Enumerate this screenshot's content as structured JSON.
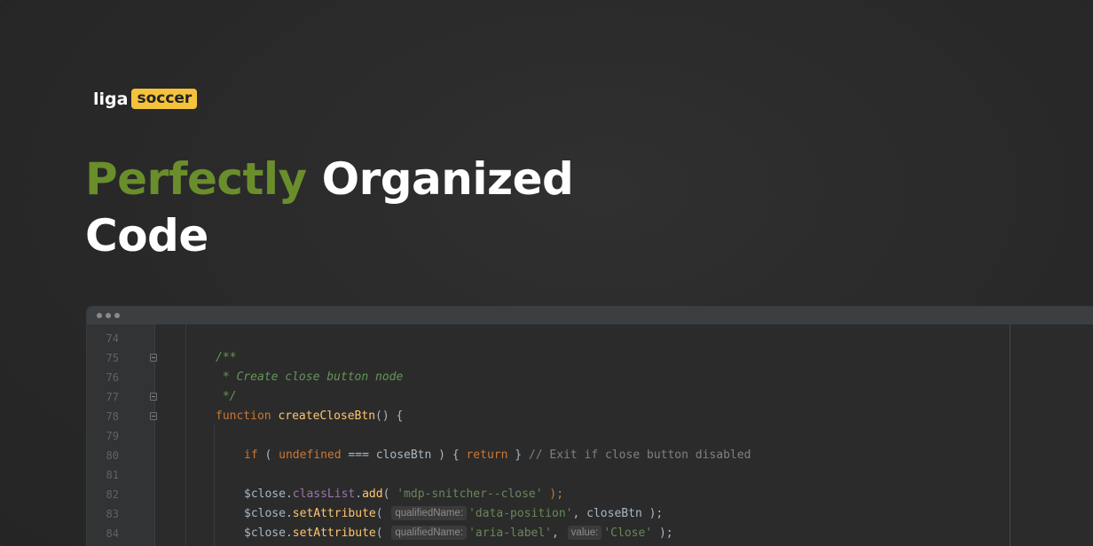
{
  "logo": {
    "liga": "liga",
    "soccer": "soccer"
  },
  "headline": {
    "accent": "Perfectly",
    "rest": "Organized",
    "line2": "Code"
  },
  "editor": {
    "lines": [
      {
        "num": "74"
      },
      {
        "num": "75",
        "t1": "/**"
      },
      {
        "num": "76",
        "t1": " * Create close button node"
      },
      {
        "num": "77",
        "t1": " */"
      },
      {
        "num": "78",
        "kw": "function",
        "fn": "createCloseBtn",
        "rest": "() {"
      },
      {
        "num": "79"
      },
      {
        "num": "80",
        "kw1": "if",
        "p1": " ( ",
        "kw2": "undefined",
        "p2": " === closeBtn ) { ",
        "kw3": "return",
        "p3": " } ",
        "comment": "// Exit if close button disabled"
      },
      {
        "num": "81"
      },
      {
        "num": "82",
        "obj": "$close.",
        "member": "classList",
        "dot": ".",
        "fn": "add",
        "p1": "( ",
        "str": "'mdp-snitcher--close'",
        "p2": " );"
      },
      {
        "num": "83",
        "obj": "$close.",
        "fn": "setAttribute",
        "p1": "( ",
        "hint1": "qualifiedName:",
        "str": "'data-position'",
        "p2": ", closeBtn );"
      },
      {
        "num": "84",
        "obj": "$close.",
        "fn": "setAttribute",
        "p1": "( ",
        "hint1": "qualifiedName:",
        "str": "'aria-label'",
        "p2": ", ",
        "hint2": "value:",
        "str2": "'Close'",
        "p3": " );"
      }
    ]
  },
  "colors": {
    "accent": "#6a8e2b",
    "logo_badge": "#f5c23b",
    "keyword": "#cc7832",
    "function": "#ffc66d",
    "string": "#6a8759",
    "comment": "#629755"
  },
  "icons": [
    "window-dot-icon",
    "fold-marker-icon"
  ]
}
